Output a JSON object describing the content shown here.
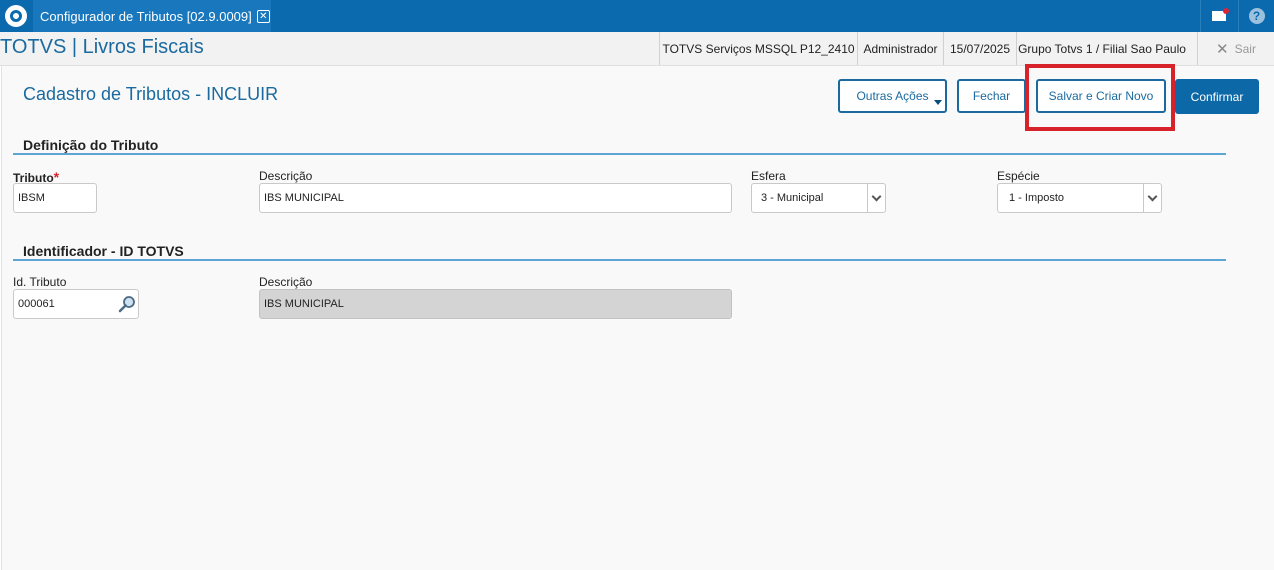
{
  "topbar": {
    "tab_title": "Configurador de Tributos [02.9.0009]",
    "tab_close": "✕",
    "help": "?"
  },
  "header": {
    "app_title": "TOTVS | Livros Fiscais",
    "server": "TOTVS Serviços MSSQL P12_2410",
    "user": "Administrador",
    "date": "15/07/2025",
    "group": "Grupo Totvs 1 / Filial Sao Paulo",
    "exit_icon": "✕",
    "exit_label": "Sair"
  },
  "page": {
    "title": "Cadastro de Tributos - INCLUIR"
  },
  "actions": {
    "outras": "Outras Ações",
    "fechar": "Fechar",
    "salvar": "Salvar e Criar Novo",
    "confirmar": "Confirmar"
  },
  "section1": {
    "title": "Definição do Tributo",
    "tributo_label": "Tributo",
    "tributo_required": "*",
    "tributo_value": "IBSM",
    "descricao_label": "Descrição",
    "descricao_value": "IBS MUNICIPAL",
    "esfera_label": "Esfera",
    "esfera_value": "3 - Municipal",
    "especie_label": "Espécie",
    "especie_value": "1 - Imposto"
  },
  "section2": {
    "title": "Identificador - ID TOTVS",
    "id_label": "Id. Tributo",
    "id_value": "000061",
    "descricao_label": "Descrição",
    "descricao_value": "IBS MUNICIPAL"
  },
  "colors": {
    "topbar": "#0a6aad",
    "accent": "#1a6aa0",
    "primary_button": "#0d68a8",
    "highlight": "#d8222a",
    "section_line": "#5ba6d4"
  }
}
